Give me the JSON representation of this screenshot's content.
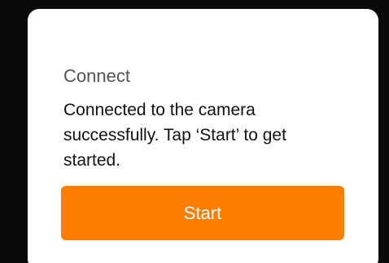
{
  "dialog": {
    "title": "Connect",
    "message": "Connected to the camera successfully. Tap ‘Start’ to get started.",
    "primary_button_label": "Start"
  },
  "colors": {
    "accent": "#ff7e00",
    "backdrop": "#0a0a0a",
    "dialog_background": "#ffffff",
    "title_text": "#555555",
    "body_text": "#111111"
  }
}
